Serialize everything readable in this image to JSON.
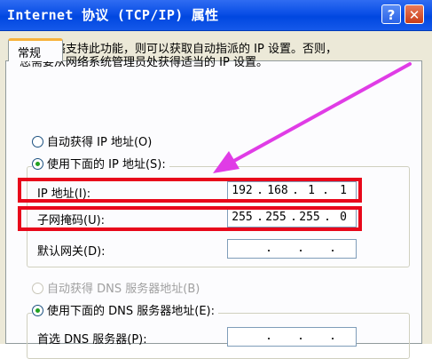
{
  "window": {
    "title": "Internet 协议 (TCP/IP) 属性",
    "help_glyph": "?",
    "close_glyph": "✕"
  },
  "tab": {
    "label": "常规"
  },
  "description": {
    "line1": "如果网络支持此功能，则可以获取自动指派的 IP 设置。否则，",
    "line2": "您需要从网络系统管理员处获得适当的 IP 设置。"
  },
  "ip_section": {
    "auto_label": "自动获得 IP 地址(O)",
    "manual_label": "使用下面的 IP 地址(S):",
    "selected": "manual",
    "ip_address": {
      "label": "IP 地址(I):",
      "octets": [
        "192",
        "168",
        "1",
        "1"
      ]
    },
    "subnet_mask": {
      "label": "子网掩码(U):",
      "octets": [
        "255",
        "255",
        "255",
        "0"
      ]
    },
    "default_gateway": {
      "label": "默认网关(D):",
      "octets": [
        "",
        "",
        "",
        ""
      ]
    }
  },
  "dns_section": {
    "auto_label": "自动获得 DNS 服务器地址(B)",
    "manual_label": "使用下面的 DNS 服务器地址(E):",
    "selected": "manual",
    "preferred": {
      "label": "首选 DNS 服务器(P):",
      "octets": [
        "",
        "",
        "",
        ""
      ]
    }
  },
  "colors": {
    "highlight_box": "#e8081b",
    "arrow": "#e03ce6",
    "titlebar": "#0a4fe6"
  }
}
